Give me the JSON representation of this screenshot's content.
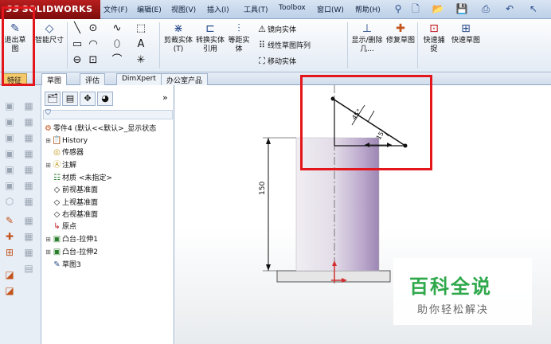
{
  "app": {
    "logo_prefix": "3S",
    "logo_text": "SOLIDWORKS"
  },
  "menu": [
    {
      "label": "文件(F)"
    },
    {
      "label": "编辑(E)"
    },
    {
      "label": "视图(V)"
    },
    {
      "label": "插入(I)"
    },
    {
      "label": "工具(T)"
    },
    {
      "label": "Toolbox"
    },
    {
      "label": "窗口(W)"
    },
    {
      "label": "帮助(H)"
    }
  ],
  "ribbon": {
    "exit_sketch": "退出草图",
    "smart_dim": "智能尺寸",
    "trim_entities": "剪裁实体(T)",
    "convert_entities": "转换实体引用",
    "offset_entities": "等距实体",
    "mirror_entities": "镜向实体",
    "linear_pattern": "线性草图阵列",
    "move_entities": "移动实体",
    "display_delete": "显示/删除几...",
    "repair_sketch": "修复草图",
    "quick_snap": "快速捕捉",
    "rapid_sketch": "快速草图"
  },
  "tabs": [
    {
      "label": "特征"
    },
    {
      "label": "草图"
    },
    {
      "label": "评估"
    },
    {
      "label": "DimXpert"
    },
    {
      "label": "办公室产品"
    }
  ],
  "tree": {
    "root": "零件4  (默认<<默认>_显示状态",
    "items": [
      {
        "label": "History",
        "icon": "history-icon"
      },
      {
        "label": "传感器",
        "icon": "sensor-icon"
      },
      {
        "label": "注解",
        "icon": "annotation-icon"
      },
      {
        "label": "材质 <未指定>",
        "icon": "material-icon"
      },
      {
        "label": "前视基准面",
        "icon": "plane-icon"
      },
      {
        "label": "上视基准面",
        "icon": "plane-icon"
      },
      {
        "label": "右视基准面",
        "icon": "plane-icon"
      },
      {
        "label": "原点",
        "icon": "origin-icon"
      },
      {
        "label": "凸台-拉伸1",
        "icon": "extrude-icon"
      },
      {
        "label": "凸台-拉伸2",
        "icon": "extrude-icon"
      },
      {
        "label": "草图3",
        "icon": "sketch-icon"
      }
    ]
  },
  "drawing": {
    "dim_height": "150",
    "dim_angle": "45°",
    "dim_length": "15"
  },
  "watermark": {
    "title": "百科全说",
    "subtitle": "助你轻松解决"
  },
  "colors": {
    "highlight": "#e3161b",
    "watermark_green": "#2ea84a",
    "cylinder": "#d8d0e0"
  }
}
